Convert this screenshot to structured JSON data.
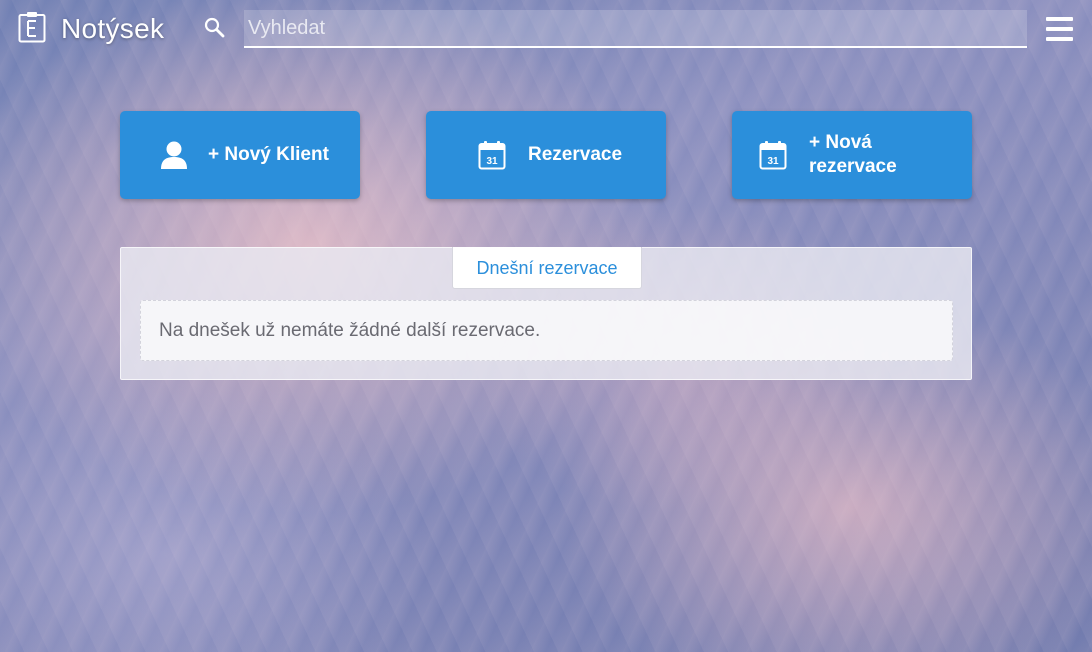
{
  "header": {
    "brand": "Notýsek",
    "search": {
      "placeholder": "Vyhledat",
      "value": ""
    }
  },
  "actions": {
    "new_client_label": "+ Nový Klient",
    "reservations_label": "Rezervace",
    "new_reservation_label": "+ Nová rezervace",
    "calendar_day": "31"
  },
  "today_panel": {
    "tab_label": "Dnešní rezervace",
    "empty_message": "Na dnešek už nemáte žádné další rezervace."
  },
  "colors": {
    "accent": "#2b8fdb",
    "button_text": "#ffffff"
  },
  "icons": [
    "notepad-logo-icon",
    "search-icon",
    "hamburger-menu-icon",
    "user-icon",
    "calendar-icon"
  ]
}
